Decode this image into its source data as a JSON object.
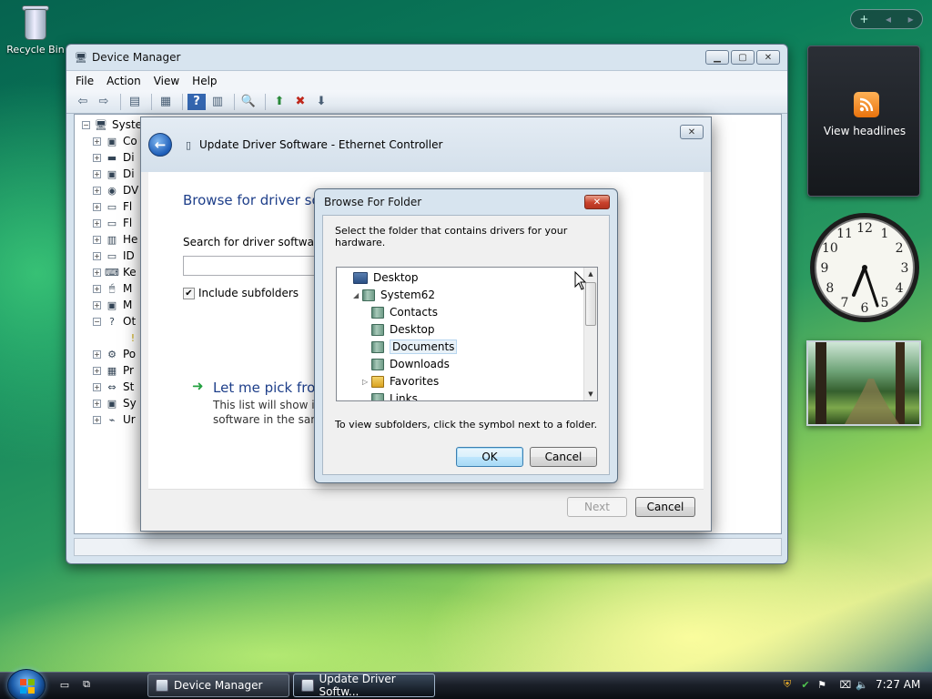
{
  "desktop": {
    "recycle_bin_label": "Recycle Bin"
  },
  "device_manager": {
    "title": "Device Manager",
    "menu": [
      "File",
      "Action",
      "View",
      "Help"
    ],
    "tree_root": "System",
    "tree_items": [
      "Co",
      "Di",
      "Di",
      "DV",
      "Fl",
      "Fl",
      "He",
      "ID",
      "Ke",
      "M",
      "M",
      "Ot",
      "",
      "Po",
      "Pr",
      "St",
      "Sy",
      "Ur"
    ]
  },
  "update_driver": {
    "title": "Update Driver Software - Ethernet Controller",
    "heading": "Browse for driver sof",
    "search_label": "Search for driver software in",
    "search_value": "",
    "include_subfolders_label": "Include subfolders",
    "include_subfolders_checked": true,
    "pick_title": "Let me pick from",
    "pick_desc_line1": "This list will show inst",
    "pick_desc_line2": "software in the same",
    "next_label": "Next",
    "cancel_label": "Cancel"
  },
  "browse_folder": {
    "title": "Browse For Folder",
    "instruction": "Select the folder that contains drivers for your hardware.",
    "tree": [
      {
        "label": "Desktop",
        "level": 0,
        "expander": ""
      },
      {
        "label": "System62",
        "level": 1,
        "expander": "◢"
      },
      {
        "label": "Contacts",
        "level": 2,
        "expander": ""
      },
      {
        "label": "Desktop",
        "level": 2,
        "expander": ""
      },
      {
        "label": "Documents",
        "level": 2,
        "expander": ""
      },
      {
        "label": "Downloads",
        "level": 2,
        "expander": ""
      },
      {
        "label": "Favorites",
        "level": 2,
        "expander": "▷"
      },
      {
        "label": "Links",
        "level": 2,
        "expander": ""
      }
    ],
    "hint": "To view subfolders, click the symbol next to a folder.",
    "ok_label": "OK",
    "cancel_label": "Cancel"
  },
  "gadgets": {
    "feed_label": "View headlines",
    "clock_numbers": [
      "12",
      "1",
      "2",
      "3",
      "4",
      "5",
      "6",
      "7",
      "8",
      "9",
      "10",
      "11"
    ]
  },
  "taskbar": {
    "tasks": [
      "Device Manager",
      "Update Driver Softw..."
    ],
    "time": "7:27 AM"
  },
  "colors": {
    "accent_blue": "#1d5db8",
    "wizard_heading": "#1e3f8a",
    "arrow_green": "#23a040"
  }
}
